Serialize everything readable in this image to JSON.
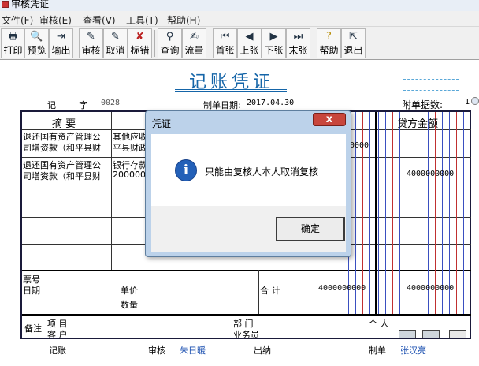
{
  "window": {
    "title": "审核凭证"
  },
  "menu": [
    "文件(F)",
    "审核(E)",
    "查看(V)",
    "工具(T)",
    "帮助(H)"
  ],
  "toolbar": [
    "打印",
    "预览",
    "输出",
    "审核",
    "取消",
    "标错",
    "查询",
    "流量",
    "首张",
    "上张",
    "下张",
    "末张",
    "帮助",
    "退出"
  ],
  "voucher": {
    "title": "记账凭证",
    "zi_label": "记",
    "zi_suffix": "字",
    "number": "0028",
    "date_label": "制单日期:",
    "date": "2017.04.30",
    "attach_label": "附单据数:",
    "attach_count": "1",
    "header_summary": "摘 要",
    "header_credit": "贷方金额",
    "rows": [
      {
        "summary_line1": "退还国有资产管理公",
        "summary_line2": "司增资款（和平县财",
        "subject_line1": "其他应收",
        "subject_line2": "平县财政",
        "debit_tail": "0000",
        "credit": ""
      },
      {
        "summary_line1": "退还国有资产管理公",
        "summary_line2": "司增资款（和平县财",
        "subject_line1": "银行存款",
        "subject_line2": "2000001",
        "debit_tail": "",
        "credit": "4000000000"
      }
    ],
    "ticket_label": "票号",
    "date_field_label": "日期",
    "unit_price_label": "单价",
    "quantity_label": "数量",
    "total_label": "合 计",
    "total_debit": "4000000000",
    "total_credit": "4000000000",
    "remarks_label": "备注",
    "project_label": "项 目",
    "dept_label": "部 门",
    "person_label": "个 人",
    "customer_label": "客 户",
    "salesman_label": "业务员",
    "bookkeeper_label": "记账",
    "auditor_label": "审核",
    "auditor": "朱日暖",
    "cashier_label": "出纳",
    "maker_label": "制单",
    "maker": "张汉亮"
  },
  "dialog": {
    "title": "凭证",
    "message": "只能由复核人本人取消复核",
    "ok_label": "确定",
    "close_label": "x",
    "info_glyph": "i"
  },
  "colors": {
    "title_blue": "#1565a8",
    "grid_line": "#1a1a3a",
    "dialog_frame": "#bcd2ea",
    "close_red": "#c8463c"
  }
}
